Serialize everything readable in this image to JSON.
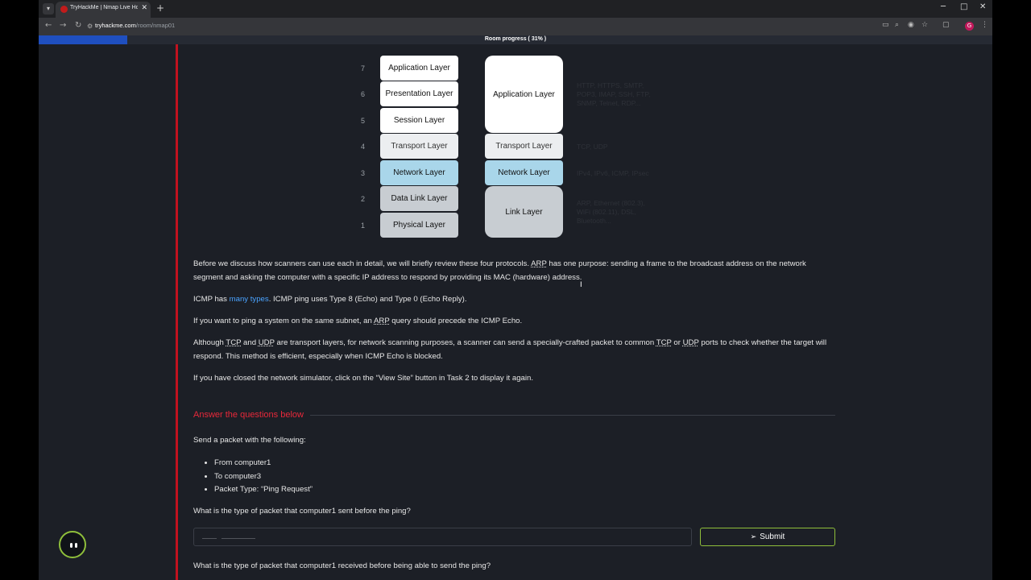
{
  "browser": {
    "tab_title": "TryHackMe | Nmap Live Host D",
    "tab_close": "✕",
    "new_tab": "+",
    "url_host": "tryhackme.com",
    "url_path": "/room/nmap01",
    "profile_initial": "G"
  },
  "progress": {
    "label": "Room progress ( 31% )",
    "percent": 31
  },
  "diagram": {
    "layer_numbers": [
      "7",
      "6",
      "5",
      "4",
      "3",
      "2",
      "1"
    ],
    "osi_layers": [
      "Application Layer",
      "Presentation Layer",
      "Session Layer",
      "Transport Layer",
      "Network Layer",
      "Data Link Layer",
      "Physical Layer"
    ],
    "tcpip_layers": [
      "Application Layer",
      "Transport Layer",
      "Network Layer",
      "Link Layer"
    ],
    "protocols": {
      "application": "HTTP, HTTPS, SMTP, POP3, IMAP, SSH, FTP, SNMP, Telnet, RDP...",
      "transport": "TCP, UDP",
      "network": "IPv4, IPv6, ICMP, IPsec",
      "link": "ARP, Ethernet (802.3), WiFi (802.11), DSL, Bluetooth..."
    }
  },
  "content": {
    "p1_a": "Before we discuss how scanners can use each in detail, we will briefly review these four protocols. ",
    "p1_arp": "ARP",
    "p1_b": " has one purpose: sending a frame to the broadcast address on the network segment and asking the computer with a specific IP address to respond by providing its MAC (hardware) address.",
    "p2_a": "ICMP has ",
    "p2_link": "many types",
    "p2_b": ". ICMP ping uses Type 8 (Echo) and Type 0 (Echo Reply).",
    "p3_a": "If you want to ping a system on the same subnet, an ",
    "p3_arp": "ARP",
    "p3_b": " query should precede the ICMP Echo.",
    "p4_a": "Although ",
    "p4_tcp": "TCP",
    "p4_and": " and ",
    "p4_udp": "UDP",
    "p4_b": " are transport layers, for network scanning purposes, a scanner can send a specially-crafted packet to common ",
    "p4_tcp2": "TCP",
    "p4_or": " or ",
    "p4_udp2": "UDP",
    "p4_c": " ports to check whether the target will respond. This method is efficient, especially when ICMP Echo is blocked.",
    "p5": "If you have closed the network simulator, click on the “View Site” button in Task 2 to display it again."
  },
  "questions": {
    "heading": "Answer the questions below",
    "intro": "Send a packet with the following:",
    "bullets": [
      "From computer1",
      "To computer3",
      "Packet Type: “Ping Request”"
    ],
    "q1": "What is the type of packet that computer1 sent before the ping?",
    "q1_placeholder": "___ _______",
    "submit_label": "Submit",
    "q2": "What is the type of packet that computer1 received before being able to send the ping?"
  }
}
